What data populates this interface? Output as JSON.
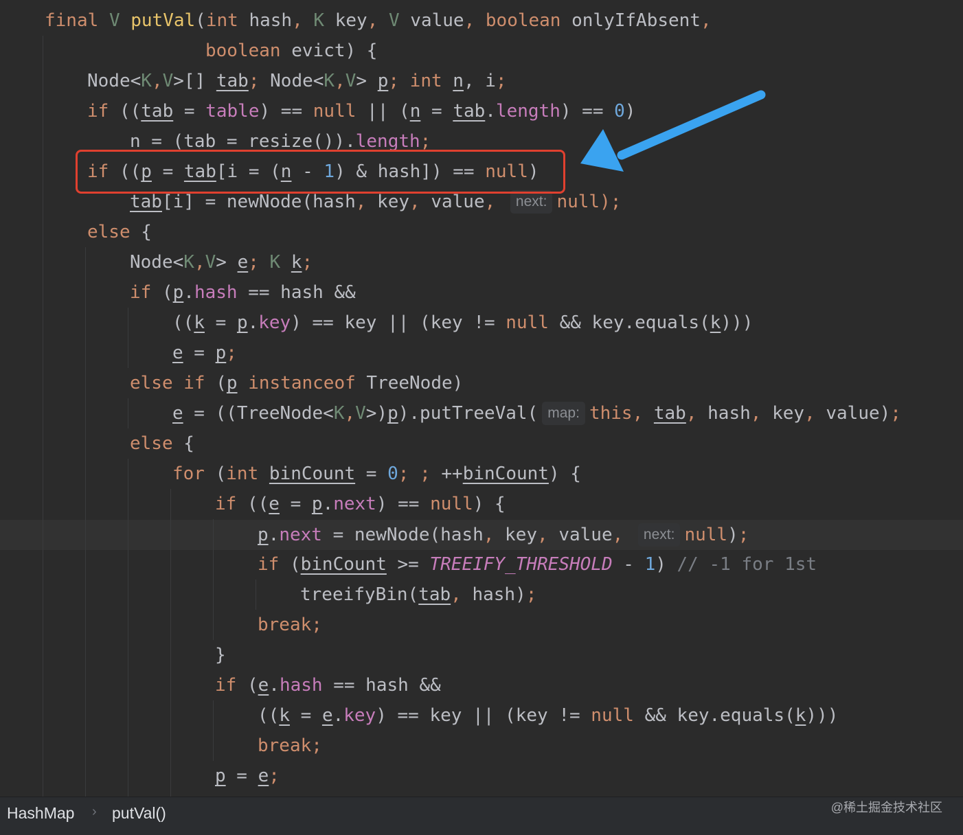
{
  "code": {
    "l1": {
      "final": "final",
      "V": "V",
      "name": "putVal",
      "open": "(",
      "int": "int",
      "hash": "hash",
      "c1": ",",
      "K": "K",
      "key": "key",
      "c2": ",",
      "V2": "V",
      "value": "value",
      "c3": ",",
      "boolean": "boolean",
      "onlyIfAbsent": "onlyIfAbsent",
      "c4": ","
    },
    "l2": {
      "boolean": "boolean",
      "rest": "evict) {"
    },
    "l3": {
      "a": "Node<",
      "K": "K",
      "c": ",",
      "V": "V",
      "b": ">[] ",
      "tab": "tab",
      "semi": ";",
      "d": " Node<",
      "K2": "K",
      "c2": ",",
      "V2": "V",
      "e": "> ",
      "p": "p",
      "semi2": ";",
      "int": "int",
      "n": "n",
      "f": ", i",
      "semi3": ";"
    },
    "l4": {
      "if": "if",
      "a": " ((",
      "tab": "tab",
      "b": " = ",
      "table": "table",
      "c": ") == ",
      "null": "null",
      "d": " || (",
      "n": "n",
      "e": " = ",
      "tab2": "tab",
      "f": ".",
      "length": "length",
      "g": ") == ",
      "zero": "0",
      "h": ")"
    },
    "l5": {
      "a": "n = (tab = resize()).",
      "length": "length",
      "semi": ";"
    },
    "l6": {
      "if": "if",
      "a": " ((",
      "p": "p",
      "b": " = ",
      "tab": "tab",
      "c": "[i = (",
      "n": "n",
      "d": " - ",
      "one": "1",
      "e": ") & hash]) == ",
      "null": "null",
      "f": ")"
    },
    "l7": {
      "tab": "tab",
      "a": "[i] = newNode(hash",
      "c1": ",",
      "b": " key",
      "c2": ",",
      "c": " value",
      "c3": ",",
      "hint": "next:",
      "null": "null",
      "d": ");"
    },
    "l8": {
      "else": "else",
      "a": " {"
    },
    "l9": {
      "a": "Node<",
      "K": "K",
      "c": ",",
      "V": "V",
      "b": "> ",
      "e": "e",
      "semi": ";",
      "K2": "K",
      "k": "k",
      "semi2": ";"
    },
    "l10": {
      "if": "if",
      "a": " (",
      "p": "p",
      "b": ".",
      "hash": "hash",
      "c": " == hash &&"
    },
    "l11": {
      "a": "((",
      "k": "k",
      "b": " = ",
      "p": "p",
      "c": ".",
      "key": "key",
      "d": ") == key || (key != ",
      "null": "null",
      "e": " && key.equals(",
      "k2": "k",
      "f": ")))"
    },
    "l12": {
      "e": "e",
      "a": " = ",
      "p": "p",
      "semi": ";"
    },
    "l13": {
      "else": "else",
      "if": "if",
      "a": " (",
      "p": "p",
      "instanceof": "instanceof",
      "b": " TreeNode)"
    },
    "l14": {
      "e": "e",
      "a": " = ((TreeNode<",
      "K": "K",
      "c": ",",
      "V": "V",
      "b": ">)",
      "p": "p",
      "d": ").putTreeVal(",
      "hint": "map:",
      "this": "this",
      "c1": ",",
      "tab": "tab",
      "c2": ",",
      "f": " hash",
      "c3": ",",
      "g": " key",
      "c4": ",",
      "h": " value)",
      "semi": ";"
    },
    "l15": {
      "else": "else",
      "a": " {"
    },
    "l16": {
      "for": "for",
      "a": " (",
      "int": "int",
      "binCount": "binCount",
      "b": " = ",
      "zero": "0",
      "semi": ";",
      "semi2": ";",
      "c": " ++",
      "binCount2": "binCount",
      "d": ") {"
    },
    "l17": {
      "if": "if",
      "a": " ((",
      "e": "e",
      "b": " = ",
      "p": "p",
      "c": ".",
      "next": "next",
      "d": ") == ",
      "null": "null",
      "f": ") {"
    },
    "l18": {
      "p": "p",
      "a": ".",
      "next": "next",
      "b": " = newNode(hash",
      "c1": ",",
      "c": " key",
      "c2": ",",
      "d": " value",
      "c3": ",",
      "hint": "next:",
      "null": "null",
      "f": ")",
      "semi": ";"
    },
    "l19": {
      "if": "if",
      "a": " (",
      "binCount": "binCount",
      "b": " >= ",
      "const": "TREEIFY_THRESHOLD",
      "c": " - ",
      "one": "1",
      "d": ") ",
      "comment": "// -1 for 1st"
    },
    "l20": {
      "a": "treeifyBin(",
      "tab": "tab",
      "c1": ",",
      "b": " hash)",
      "semi": ";"
    },
    "l21": {
      "break": "break",
      "semi": ";"
    },
    "l22": {
      "a": "}"
    },
    "l23": {
      "if": "if",
      "a": " (",
      "e": "e",
      "b": ".",
      "hash": "hash",
      "c": " == hash &&"
    },
    "l24": {
      "a": "((",
      "k": "k",
      "b": " = ",
      "e": "e",
      "c": ".",
      "key": "key",
      "d": ") == key || (key != ",
      "null": "null",
      "f": " && key.equals(",
      "k2": "k",
      "g": ")))"
    },
    "l25": {
      "break": "break",
      "semi": ";"
    },
    "l26": {
      "p": "p",
      "a": " = ",
      "e": "e",
      "semi": ";"
    }
  },
  "breadcrumb": {
    "class_name": "HashMap",
    "method_name": "putVal()"
  },
  "watermark": "@稀土掘金技术社区",
  "annotation": {
    "box_color": "#e0402f",
    "arrow_color": "#3aa3f0"
  }
}
